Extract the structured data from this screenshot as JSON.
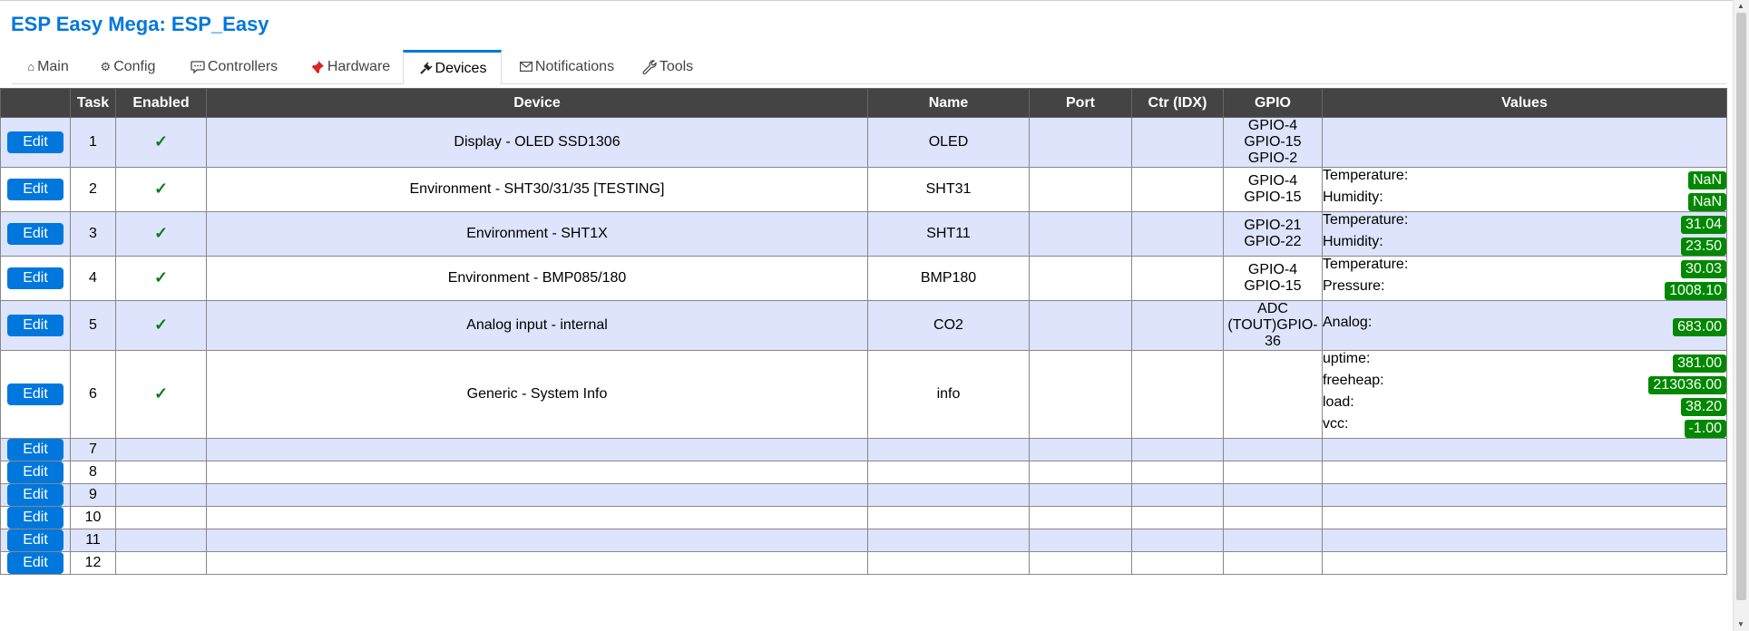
{
  "app": {
    "title": "ESP Easy Mega: ESP_Easy"
  },
  "tabs": [
    {
      "label": "Main",
      "icon": "home-icon"
    },
    {
      "label": "Config",
      "icon": "gear-icon"
    },
    {
      "label": "Controllers",
      "icon": "speech-bubble-icon"
    },
    {
      "label": "Hardware",
      "icon": "pushpin-icon"
    },
    {
      "label": "Devices",
      "icon": "plug-icon",
      "active": true
    },
    {
      "label": "Notifications",
      "icon": "envelope-icon"
    },
    {
      "label": "Tools",
      "icon": "wrench-icon"
    }
  ],
  "table": {
    "headers": [
      "",
      "Task",
      "Enabled",
      "Device",
      "Name",
      "Port",
      "Ctr (IDX)",
      "GPIO",
      "Values"
    ],
    "edit_label": "Edit",
    "check_symbol": "✓",
    "rows": [
      {
        "task": "1",
        "enabled": true,
        "device": "Display - OLED SSD1306",
        "name": "OLED",
        "port": "",
        "ctr": "",
        "gpio": [
          "GPIO-4",
          "GPIO-15",
          "GPIO-2"
        ],
        "values": []
      },
      {
        "task": "2",
        "enabled": true,
        "device": "Environment - SHT30/31/35 [TESTING]",
        "name": "SHT31",
        "port": "",
        "ctr": "",
        "gpio": [
          "GPIO-4",
          "GPIO-15"
        ],
        "values": [
          {
            "label": "Temperature:",
            "value": "NaN"
          },
          {
            "label": "Humidity:",
            "value": "NaN"
          }
        ]
      },
      {
        "task": "3",
        "enabled": true,
        "device": "Environment - SHT1X",
        "name": "SHT11",
        "port": "",
        "ctr": "",
        "gpio": [
          "GPIO-21",
          "GPIO-22"
        ],
        "values": [
          {
            "label": "Temperature:",
            "value": "31.04"
          },
          {
            "label": "Humidity:",
            "value": "23.50"
          }
        ]
      },
      {
        "task": "4",
        "enabled": true,
        "device": "Environment - BMP085/180",
        "name": "BMP180",
        "port": "",
        "ctr": "",
        "gpio": [
          "GPIO-4",
          "GPIO-15"
        ],
        "values": [
          {
            "label": "Temperature:",
            "value": "30.03"
          },
          {
            "label": "Pressure:",
            "value": "1008.10"
          }
        ]
      },
      {
        "task": "5",
        "enabled": true,
        "device": "Analog input - internal",
        "name": "CO2",
        "port": "",
        "ctr": "",
        "gpio": [
          "ADC",
          "(TOUT)GPIO-",
          "36"
        ],
        "values": [
          {
            "label": "Analog:",
            "value": "683.00"
          }
        ]
      },
      {
        "task": "6",
        "enabled": true,
        "device": "Generic - System Info",
        "name": "info",
        "port": "",
        "ctr": "",
        "gpio": [],
        "values": [
          {
            "label": "uptime:",
            "value": "381.00"
          },
          {
            "label": "freeheap:",
            "value": "213036.00"
          },
          {
            "label": "load:",
            "value": "38.20"
          },
          {
            "label": "vcc:",
            "value": "-1.00"
          }
        ]
      },
      {
        "task": "7",
        "enabled": false,
        "device": "",
        "name": "",
        "port": "",
        "ctr": "",
        "gpio": [],
        "values": []
      },
      {
        "task": "8",
        "enabled": false,
        "device": "",
        "name": "",
        "port": "",
        "ctr": "",
        "gpio": [],
        "values": []
      },
      {
        "task": "9",
        "enabled": false,
        "device": "",
        "name": "",
        "port": "",
        "ctr": "",
        "gpio": [],
        "values": []
      },
      {
        "task": "10",
        "enabled": false,
        "device": "",
        "name": "",
        "port": "",
        "ctr": "",
        "gpio": [],
        "values": []
      },
      {
        "task": "11",
        "enabled": false,
        "device": "",
        "name": "",
        "port": "",
        "ctr": "",
        "gpio": [],
        "values": []
      },
      {
        "task": "12",
        "enabled": false,
        "device": "",
        "name": "",
        "port": "",
        "ctr": "",
        "gpio": [],
        "values": []
      }
    ]
  },
  "colors": {
    "accent": "#0077dd",
    "header_bg": "#444444",
    "row_alt": "#dde4fb",
    "value_badge": "#008800",
    "check": "#0a7d1a"
  }
}
